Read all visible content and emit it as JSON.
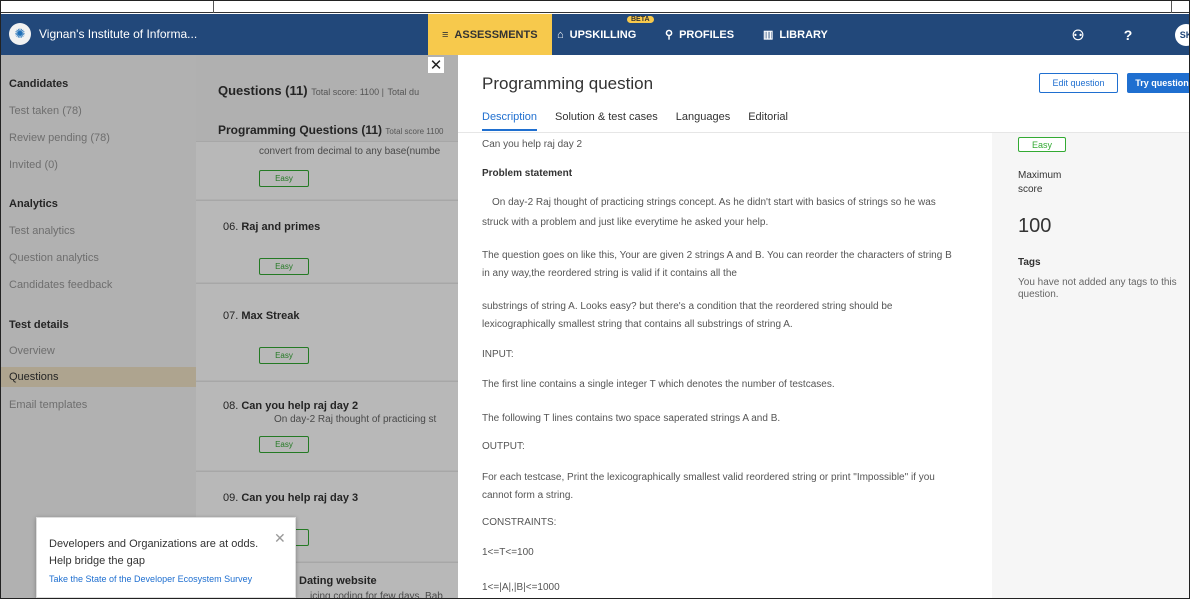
{
  "nav": {
    "org": "Vignan's Institute of Informa...",
    "tabs": [
      "ASSESSMENTS",
      "UPSKILLING",
      "PROFILES",
      "LIBRARY"
    ],
    "beta": "BETA",
    "avatar": "SK",
    "accent": "#f7c94c",
    "bg": "#22487a"
  },
  "sidebar": {
    "candidates_title": "Candidates",
    "candidates": [
      "Test taken (78)",
      "Review pending (78)",
      "Invited (0)"
    ],
    "analytics_title": "Analytics",
    "analytics": [
      "Test analytics",
      "Question analytics",
      "Candidates feedback"
    ],
    "details_title": "Test details",
    "details": [
      "Overview",
      "Questions",
      "Email templates"
    ]
  },
  "list": {
    "header": "Questions (11)",
    "header_meta": "Total score: 1100 |",
    "header_meta2": "Total du",
    "group": "Programming Questions (11)",
    "group_meta": "Total score 1100",
    "q05_desc": "convert from decimal to any base(numbe",
    "q06_num": "06.",
    "q06_title": "Raj and primes",
    "q07_num": "07.",
    "q07_title": "Max Streak",
    "q08_num": "08.",
    "q08_title": "Can you help raj day 2",
    "q08_desc": "On day-2 Raj thought of practicing st",
    "q09_num": "09.",
    "q09_title": "Can you help raj day 3",
    "q10_title": "Dating website",
    "q10_desc": "icing coding for few days. Bab",
    "difficulty": "Easy"
  },
  "panel": {
    "title": "Programming question",
    "edit_label": "Edit question",
    "try_label": "Try question",
    "tabs": [
      "Description",
      "Solution & test cases",
      "Languages",
      "Editorial"
    ],
    "question_title": "Can you help raj day 2",
    "ps_heading": "Problem statement",
    "p1": "On day-2 Raj thought of practicing strings concept. As he didn't start with basics of strings so he was struck with a problem and just like everytime he asked your help.",
    "p2": "The question goes on like this, Your are given 2 strings A and B. You can reorder the characters of string B in any way,the reordered string is valid if it contains all the",
    "p3": "substrings of string A. Looks easy? but there's a condition that the reordered string should be lexicographically smallest string that contains all substrings of string A.",
    "input_h": "INPUT:",
    "input1": "The first line contains a single integer T which denotes the number of testcases.",
    "input2": "The following T lines contains two space saperated strings A and B.",
    "output_h": "OUTPUT:",
    "output1": "For each testcase, Print the lexicographically smallest valid reordered string or print \"Impossible\" if you cannot form a string.",
    "constraints_h": "CONSTRAINTS:",
    "c1": "1<=T<=100",
    "c2": "1<=|A|,|B|<=1000",
    "difficulty": "Easy",
    "max_score_label": "Maximum score",
    "max_score": "100",
    "tags_label": "Tags",
    "tags_text": "You have not added any tags to this question."
  },
  "toast": {
    "message": "Developers and Organizations are at odds. Help bridge the gap",
    "link": "Take the State of the Developer Ecosystem Survey"
  }
}
